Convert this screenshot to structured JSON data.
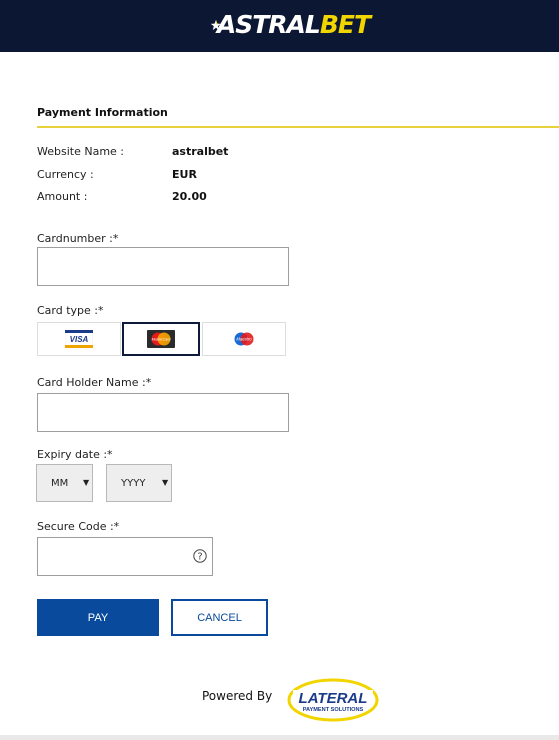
{
  "header": {
    "brand_main": "ASTRAL",
    "brand_highlight": "BET",
    "colors": {
      "bar": "#0b1733",
      "brand_yellow": "#f1d500"
    }
  },
  "payment": {
    "section_title": "Payment Information",
    "rows": [
      {
        "label": "Website Name :",
        "value": "astralbet"
      },
      {
        "label": "Currency :",
        "value": "EUR"
      },
      {
        "label": "Amount :",
        "value": "20.00"
      }
    ]
  },
  "form": {
    "cardnumber_label": "Cardnumber :*",
    "cardnumber_value": "",
    "cardtype_label": "Card type :*",
    "card_types": [
      {
        "name": "VISA",
        "icon": "visa-logo",
        "selected": false
      },
      {
        "name": "MasterCard",
        "icon": "mastercard-logo",
        "selected": true
      },
      {
        "name": "Maestro",
        "icon": "maestro-logo",
        "selected": false
      }
    ],
    "holder_label": "Card Holder Name :*",
    "holder_value": "",
    "expiry_label": "Expiry date :*",
    "month_value": "MM",
    "year_value": "YYYY",
    "secure_label": "Secure Code :*",
    "secure_value": ""
  },
  "actions": {
    "pay_label": "PAY",
    "cancel_label": "CANCEL",
    "colors": {
      "primary": "#0a4a9c"
    }
  },
  "footer": {
    "powered_by": "Powered By",
    "logo_main": "LATERAL",
    "logo_sub": "PAYMENT SOLUTIONS"
  }
}
